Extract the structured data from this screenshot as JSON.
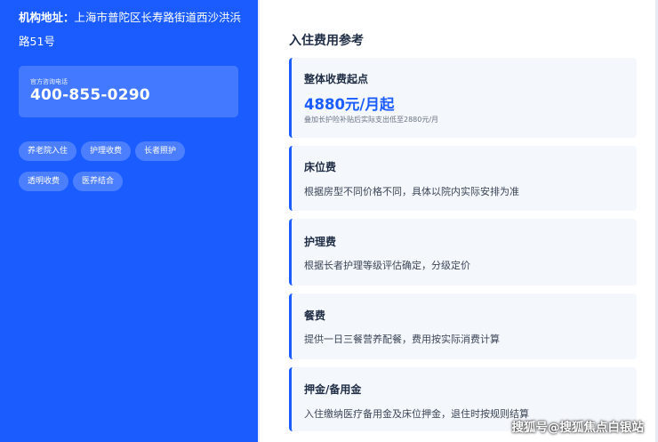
{
  "left": {
    "address_label": "机构地址：",
    "address_value": "上海市普陀区长寿路街道西沙洪浜路51号",
    "phone_label": "官方咨询电话",
    "phone_number": "400-855-0290",
    "tags": [
      "养老院入住",
      "护理收费",
      "长者照护",
      "透明收费",
      "医养结合"
    ]
  },
  "section_title": "入住费用参考",
  "cards": [
    {
      "title": "整体收费起点",
      "price": "4880元/月起",
      "note": "叠加长护险补贴后实际支出低至2880元/月"
    },
    {
      "title": "床位费",
      "desc": "根据房型不同价格不同，具体以院内实际安排为准"
    },
    {
      "title": "护理费",
      "desc": "根据长者护理等级评估确定，分级定价"
    },
    {
      "title": "餐费",
      "desc": "提供一日三餐营养配餐，费用按实际消费计算"
    },
    {
      "title": "押金/备用金",
      "desc": "入住缴纳医疗备用金及床位押金，退住时按规则结算"
    }
  ],
  "watermark": "搜狐号@搜狐焦点白银站",
  "colors": {
    "primary": "#1a5cff",
    "card_bg": "#f4f7fc",
    "title": "#1f2d45"
  }
}
